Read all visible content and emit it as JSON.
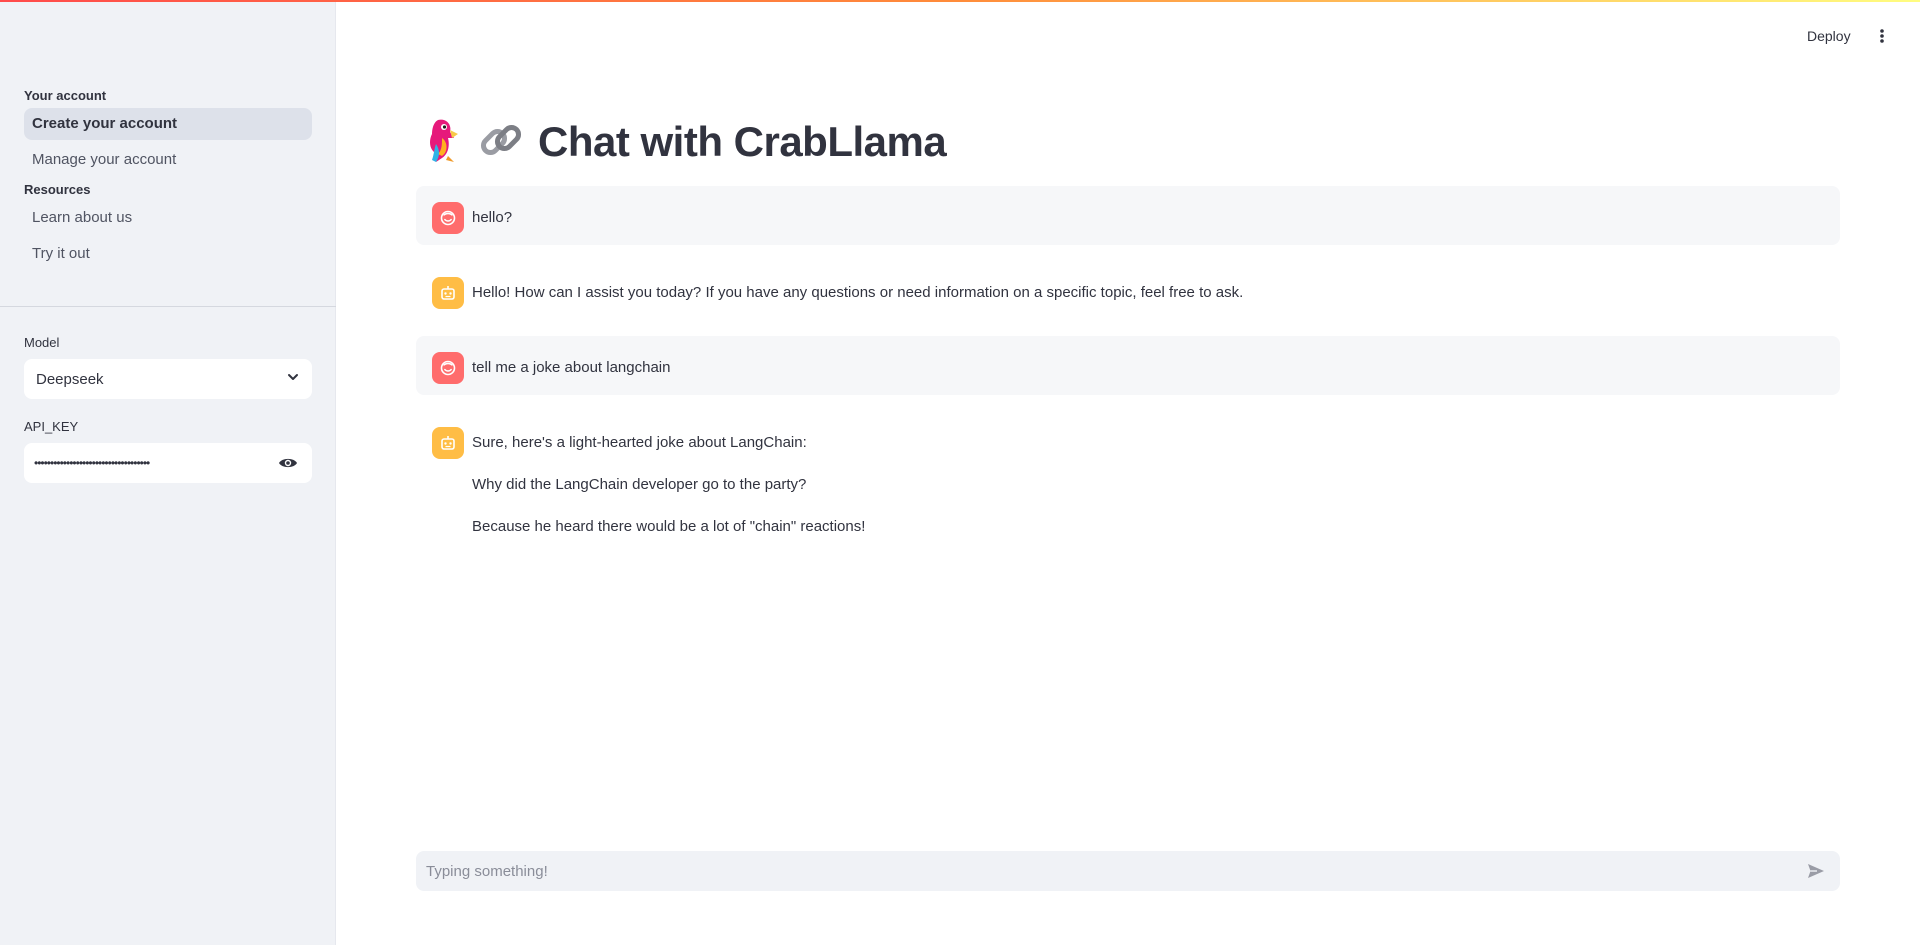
{
  "sidebar": {
    "sections": [
      {
        "title": "Your account",
        "items": [
          {
            "label": "Create your account",
            "active": true
          },
          {
            "label": "Manage your account",
            "active": false
          }
        ]
      },
      {
        "title": "Resources",
        "items": [
          {
            "label": "Learn about us",
            "active": false
          },
          {
            "label": "Try it out",
            "active": false
          }
        ]
      }
    ],
    "model_label": "Model",
    "model_value": "Deepseek",
    "api_key_label": "API_KEY",
    "api_key_value": "••••••••••••••••••••••••••••••••••••"
  },
  "header": {
    "deploy_label": "Deploy",
    "menu_icon": "vertical-dots-icon"
  },
  "main": {
    "title": "Chat with CrabLlama",
    "title_icons": [
      "parrot-icon",
      "link-icon"
    ],
    "messages": [
      {
        "role": "user",
        "paragraphs": [
          "hello?"
        ]
      },
      {
        "role": "assistant",
        "paragraphs": [
          "Hello! How can I assist you today? If you have any questions or need information on a specific topic, feel free to ask."
        ]
      },
      {
        "role": "user",
        "paragraphs": [
          "tell me a joke about langchain"
        ]
      },
      {
        "role": "assistant",
        "paragraphs": [
          "Sure, here's a light-hearted joke about LangChain:",
          "Why did the LangChain developer go to the party?",
          "Because he heard there would be a lot of \"chain\" reactions!"
        ]
      }
    ],
    "input_placeholder": "Typing something!"
  },
  "colors": {
    "user_avatar": "#ff6c6c",
    "assistant_avatar": "#ffbd45",
    "sidebar_bg": "#f0f2f6",
    "active_item_bg": "#dde1ea"
  }
}
